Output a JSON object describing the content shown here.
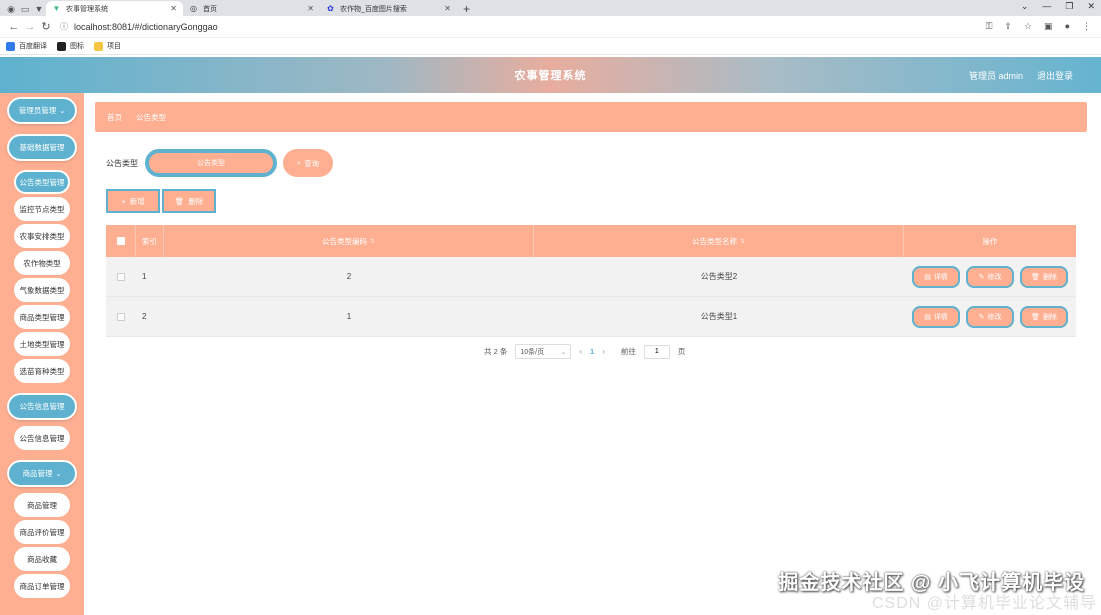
{
  "browser": {
    "tabs": [
      {
        "title": "农事管理系统",
        "active": true
      },
      {
        "title": "首页",
        "active": false
      },
      {
        "title": "农作物_百度图片搜索",
        "active": false
      }
    ],
    "url": "localhost:8081/#/dictionaryGonggao",
    "bookmarks": [
      "百度翻译",
      "图标",
      "项目"
    ]
  },
  "header": {
    "title": "农事管理系统",
    "user": "管理员 admin",
    "logout": "退出登录"
  },
  "sidebar": {
    "groups": [
      {
        "label": "管理员管理",
        "items": []
      },
      {
        "label": "基础数据管理",
        "items": [
          "公告类型管理",
          "监控节点类型",
          "农事安排类型",
          "农作物类型",
          "气象数据类型",
          "商品类型管理",
          "土地类型管理",
          "选苗育种类型"
        ]
      },
      {
        "label": "公告信息管理",
        "items": [
          "公告信息管理"
        ]
      },
      {
        "label": "商品管理",
        "items": [
          "商品管理",
          "商品评价管理",
          "商品收藏",
          "商品订单管理"
        ]
      }
    ]
  },
  "main": {
    "breadcrumb": [
      "首页",
      "公告类型"
    ],
    "search": {
      "label": "公告类型",
      "placeholder": "公告类型",
      "button": "查询"
    },
    "actions": {
      "add": "新增",
      "delete": "删除"
    },
    "table": {
      "columns": [
        "索引",
        "公告类型编码",
        "公告类型名称",
        "操作"
      ],
      "rows": [
        {
          "index": "1",
          "code": "2",
          "name": "公告类型2"
        },
        {
          "index": "2",
          "code": "1",
          "name": "公告类型1"
        }
      ],
      "row_buttons": {
        "detail": "详情",
        "edit": "修改",
        "delete": "删除"
      }
    },
    "pagination": {
      "total": "共 2 条",
      "page_size": "10条/页",
      "current": "1",
      "goto_label": "前往",
      "goto_value": "1",
      "page_suffix": "页"
    }
  },
  "watermark": {
    "line1": "掘金技术社区 @ 小飞计算机毕设",
    "line2": "CSDN @计算机毕业论文辅导"
  },
  "colors": {
    "accent_blue": "#5fb2cf",
    "accent_salmon": "#feaf91"
  }
}
